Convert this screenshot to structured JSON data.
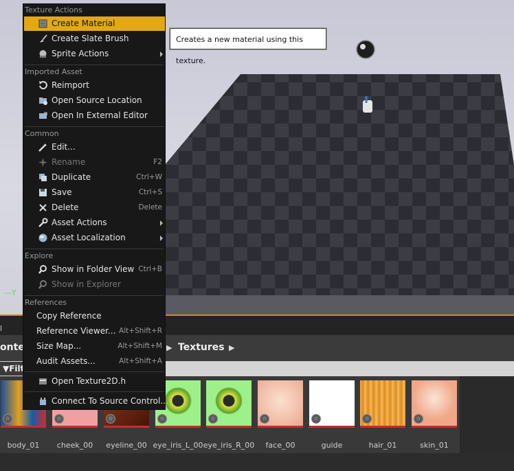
{
  "viewport": {
    "axis_label": "—Y"
  },
  "tooltip": {
    "text": "Creates a new material using this texture."
  },
  "menu": {
    "sections": {
      "texture_actions": "Texture Actions",
      "imported_asset": "Imported Asset",
      "common": "Common",
      "explore": "Explore",
      "references": "References"
    },
    "items": {
      "create_material": {
        "label": "Create Material",
        "icon": "material-icon"
      },
      "create_slate_brush": {
        "label": "Create Slate Brush",
        "icon": "brush-icon"
      },
      "sprite_actions": {
        "label": "Sprite Actions",
        "icon": "sprite-icon"
      },
      "reimport": {
        "label": "Reimport",
        "icon": "reimport-icon"
      },
      "open_source_location": {
        "label": "Open Source Location",
        "icon": "folder-icon"
      },
      "open_external_editor": {
        "label": "Open In External Editor",
        "icon": "external-editor-icon"
      },
      "edit": {
        "label": "Edit...",
        "icon": "edit-icon"
      },
      "rename": {
        "label": "Rename",
        "shortcut": "F2",
        "icon": "rename-icon"
      },
      "duplicate": {
        "label": "Duplicate",
        "shortcut": "Ctrl+W",
        "icon": "duplicate-icon"
      },
      "save": {
        "label": "Save",
        "shortcut": "Ctrl+S",
        "icon": "save-icon"
      },
      "delete": {
        "label": "Delete",
        "shortcut": "Delete",
        "icon": "delete-icon"
      },
      "asset_actions": {
        "label": "Asset Actions",
        "icon": "wrench-icon"
      },
      "asset_localization": {
        "label": "Asset Localization",
        "icon": "globe-icon"
      },
      "show_in_folder_view": {
        "label": "Show in Folder View",
        "shortcut": "Ctrl+B",
        "icon": "search-folder-icon"
      },
      "show_in_explorer": {
        "label": "Show in Explorer",
        "icon": "search-explorer-icon"
      },
      "copy_reference": {
        "label": "Copy Reference"
      },
      "reference_viewer": {
        "label": "Reference Viewer...",
        "shortcut": "Alt+Shift+R"
      },
      "size_map": {
        "label": "Size Map...",
        "shortcut": "Alt+Shift+M"
      },
      "audit_assets": {
        "label": "Audit Assets...",
        "shortcut": "Alt+Shift+A"
      },
      "open_texture2d": {
        "label": "Open Texture2D.h",
        "icon": "header-file-icon"
      },
      "connect_source_control": {
        "label": "Connect To Source Control...",
        "icon": "source-control-icon"
      }
    }
  },
  "browser": {
    "tab_stub": "l",
    "path_left": "onter",
    "path_item": "Textures",
    "filter_label": "Filt",
    "assets": [
      {
        "name": "body_01",
        "color": "#2a7ec2"
      },
      {
        "name": "cheek_00",
        "color": "#f0a0a0"
      },
      {
        "name": "eyeline_00",
        "color": "#6a2418"
      },
      {
        "name": "eye_iris_L_00",
        "color": "#9ef08a"
      },
      {
        "name": "eye_iris_R_00",
        "color": "#9ef08a"
      },
      {
        "name": "face_00",
        "color": "#f4c4ae"
      },
      {
        "name": "guide",
        "color": "#ffffff"
      },
      {
        "name": "hair_01",
        "color": "#e79a3a"
      },
      {
        "name": "skin_01",
        "color": "#f0a888"
      }
    ]
  },
  "colors": {
    "accent": "#e2a914",
    "asset_underline": "#c03030"
  }
}
